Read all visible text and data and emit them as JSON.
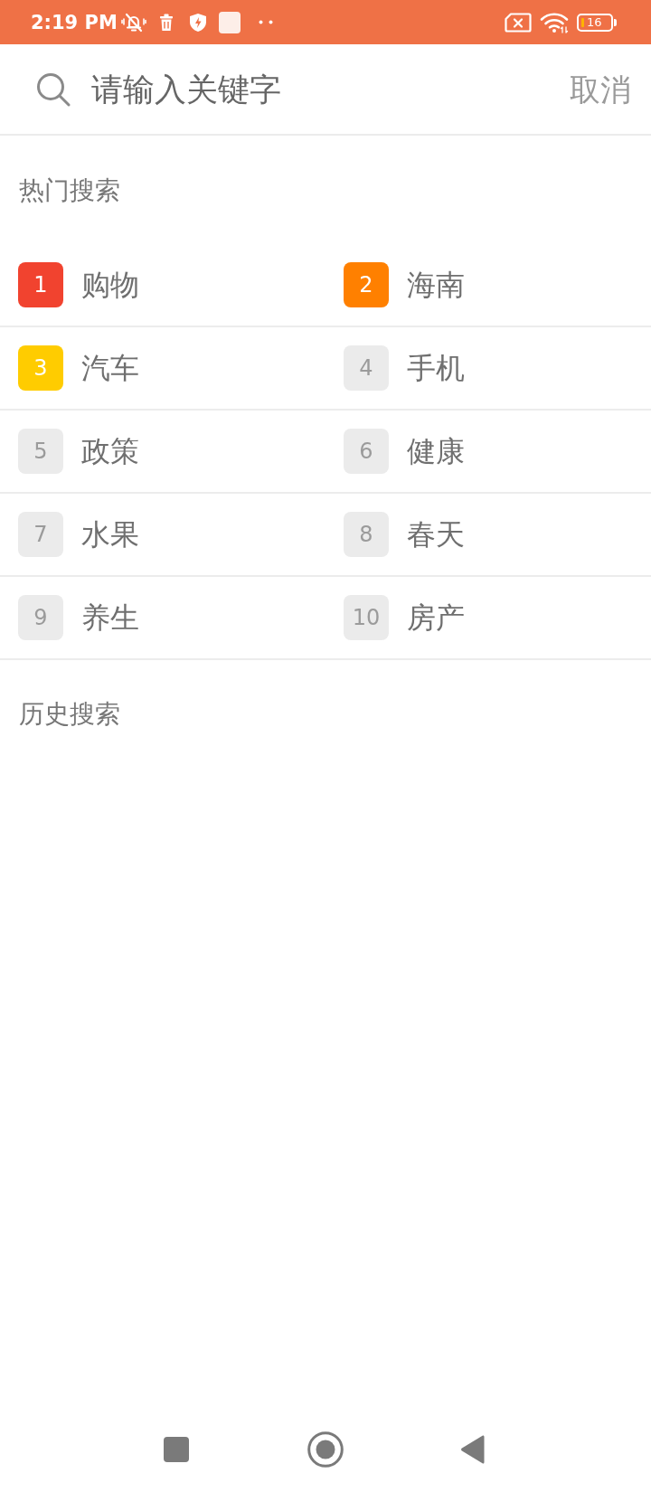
{
  "status_bar": {
    "time": "2:19 PM",
    "battery": "16"
  },
  "search": {
    "placeholder": "请输入关键字",
    "cancel": "取消"
  },
  "hot_search": {
    "title": "热门搜索",
    "items": [
      {
        "rank": "1",
        "label": "购物",
        "kind": "top",
        "color": "#f1432f"
      },
      {
        "rank": "2",
        "label": "海南",
        "kind": "top",
        "color": "#ff8000"
      },
      {
        "rank": "3",
        "label": "汽车",
        "kind": "top",
        "color": "#ffcc00"
      },
      {
        "rank": "4",
        "label": "手机",
        "kind": "normal",
        "color": "#ebebeb"
      },
      {
        "rank": "5",
        "label": "政策",
        "kind": "normal",
        "color": "#ebebeb"
      },
      {
        "rank": "6",
        "label": "健康",
        "kind": "normal",
        "color": "#ebebeb"
      },
      {
        "rank": "7",
        "label": "水果",
        "kind": "normal",
        "color": "#ebebeb"
      },
      {
        "rank": "8",
        "label": "春天",
        "kind": "normal",
        "color": "#ebebeb"
      },
      {
        "rank": "9",
        "label": "养生",
        "kind": "normal",
        "color": "#ebebeb"
      },
      {
        "rank": "10",
        "label": "房产",
        "kind": "normal",
        "color": "#ebebeb"
      }
    ]
  },
  "history": {
    "title": "历史搜索"
  }
}
